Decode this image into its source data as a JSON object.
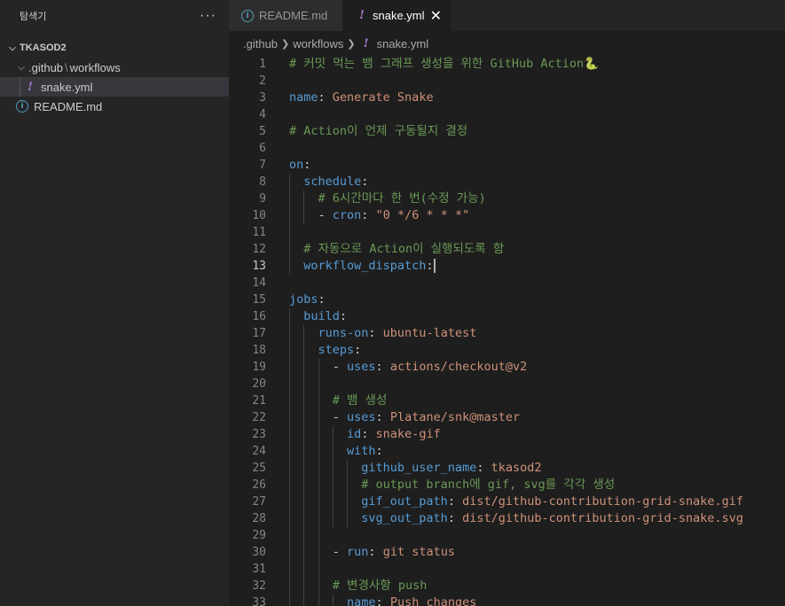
{
  "sidebar": {
    "title": "탐색기",
    "more": "···",
    "section": "TKASOD2",
    "folder_a": ".github",
    "folder_b": "workflows",
    "file1": "snake.yml",
    "file2": "README.md"
  },
  "tabs": [
    {
      "label": "README.md"
    },
    {
      "label": "snake.yml",
      "close": "✕"
    }
  ],
  "breadcrumbs": [
    ".github",
    "workflows",
    "snake.yml"
  ],
  "editor": {
    "current_line": 13,
    "lines": [
      [
        [
          "c",
          "# 커밋 먹는 뱀 그래프 생성을 위한 GitHub Action🐍"
        ]
      ],
      [],
      [
        [
          "k",
          "name"
        ],
        [
          "p",
          ": "
        ],
        [
          "s",
          "Generate Snake"
        ]
      ],
      [],
      [
        [
          "c",
          "# Action이 언제 구동될지 결정"
        ]
      ],
      [],
      [
        [
          "k",
          "on"
        ],
        [
          "p",
          ":"
        ]
      ],
      [
        [
          "k",
          "  schedule"
        ],
        [
          "p",
          ":"
        ]
      ],
      [
        [
          "c",
          "    # 6시간마다 한 번(수정 가능)"
        ]
      ],
      [
        [
          "p",
          "    - "
        ],
        [
          "k",
          "cron"
        ],
        [
          "p",
          ": "
        ],
        [
          "s",
          "\"0 */6 * * *\""
        ]
      ],
      [],
      [
        [
          "c",
          "  # 자동으로 Action이 실행되도록 함"
        ]
      ],
      [
        [
          "k",
          "  workflow_dispatch"
        ],
        [
          "p",
          ":"
        ]
      ],
      [],
      [
        [
          "k",
          "jobs"
        ],
        [
          "p",
          ":"
        ]
      ],
      [
        [
          "k",
          "  build"
        ],
        [
          "p",
          ":"
        ]
      ],
      [
        [
          "k",
          "    runs-on"
        ],
        [
          "p",
          ": "
        ],
        [
          "s",
          "ubuntu-latest"
        ]
      ],
      [
        [
          "k",
          "    steps"
        ],
        [
          "p",
          ":"
        ]
      ],
      [
        [
          "p",
          "      - "
        ],
        [
          "k",
          "uses"
        ],
        [
          "p",
          ": "
        ],
        [
          "s",
          "actions/checkout@v2"
        ]
      ],
      [],
      [
        [
          "c",
          "      # 뱀 생성"
        ]
      ],
      [
        [
          "p",
          "      - "
        ],
        [
          "k",
          "uses"
        ],
        [
          "p",
          ": "
        ],
        [
          "s",
          "Platane/snk@master"
        ]
      ],
      [
        [
          "k",
          "        id"
        ],
        [
          "p",
          ": "
        ],
        [
          "s",
          "snake-gif"
        ]
      ],
      [
        [
          "k",
          "        with"
        ],
        [
          "p",
          ":"
        ]
      ],
      [
        [
          "k",
          "          github_user_name"
        ],
        [
          "p",
          ": "
        ],
        [
          "s",
          "tkasod2"
        ]
      ],
      [
        [
          "c",
          "          # output branch에 gif, svg를 각각 생성"
        ]
      ],
      [
        [
          "k",
          "          gif_out_path"
        ],
        [
          "p",
          ": "
        ],
        [
          "s",
          "dist/github-contribution-grid-snake.gif"
        ]
      ],
      [
        [
          "k",
          "          svg_out_path"
        ],
        [
          "p",
          ": "
        ],
        [
          "s",
          "dist/github-contribution-grid-snake.svg"
        ]
      ],
      [],
      [
        [
          "p",
          "      - "
        ],
        [
          "k",
          "run"
        ],
        [
          "p",
          ": "
        ],
        [
          "s",
          "git status"
        ]
      ],
      [],
      [
        [
          "c",
          "      # 변경사항 push"
        ]
      ],
      [
        [
          "p",
          "        "
        ],
        [
          "k",
          "name"
        ],
        [
          "p",
          ": "
        ],
        [
          "s",
          "Push changes"
        ]
      ]
    ]
  }
}
